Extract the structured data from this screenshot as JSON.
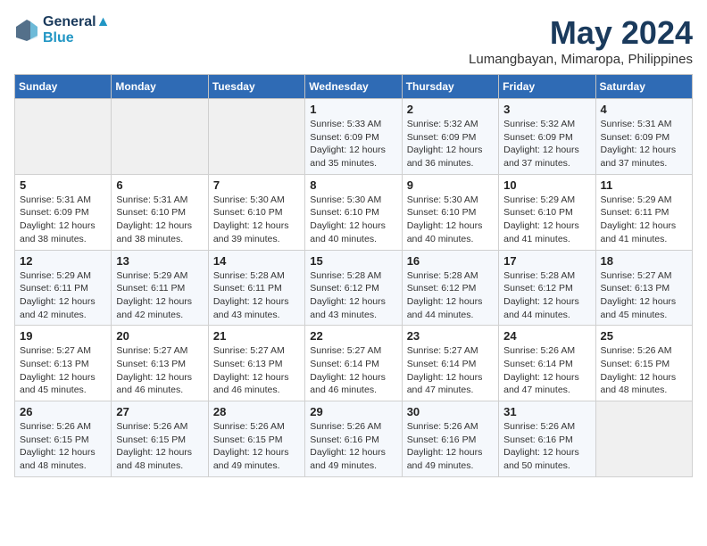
{
  "header": {
    "logo_line1": "General",
    "logo_line2": "Blue",
    "month": "May 2024",
    "location": "Lumangbayan, Mimaropa, Philippines"
  },
  "weekdays": [
    "Sunday",
    "Monday",
    "Tuesday",
    "Wednesday",
    "Thursday",
    "Friday",
    "Saturday"
  ],
  "weeks": [
    [
      {
        "day": "",
        "info": ""
      },
      {
        "day": "",
        "info": ""
      },
      {
        "day": "",
        "info": ""
      },
      {
        "day": "1",
        "info": "Sunrise: 5:33 AM\nSunset: 6:09 PM\nDaylight: 12 hours\nand 35 minutes."
      },
      {
        "day": "2",
        "info": "Sunrise: 5:32 AM\nSunset: 6:09 PM\nDaylight: 12 hours\nand 36 minutes."
      },
      {
        "day": "3",
        "info": "Sunrise: 5:32 AM\nSunset: 6:09 PM\nDaylight: 12 hours\nand 37 minutes."
      },
      {
        "day": "4",
        "info": "Sunrise: 5:31 AM\nSunset: 6:09 PM\nDaylight: 12 hours\nand 37 minutes."
      }
    ],
    [
      {
        "day": "5",
        "info": "Sunrise: 5:31 AM\nSunset: 6:09 PM\nDaylight: 12 hours\nand 38 minutes."
      },
      {
        "day": "6",
        "info": "Sunrise: 5:31 AM\nSunset: 6:10 PM\nDaylight: 12 hours\nand 38 minutes."
      },
      {
        "day": "7",
        "info": "Sunrise: 5:30 AM\nSunset: 6:10 PM\nDaylight: 12 hours\nand 39 minutes."
      },
      {
        "day": "8",
        "info": "Sunrise: 5:30 AM\nSunset: 6:10 PM\nDaylight: 12 hours\nand 40 minutes."
      },
      {
        "day": "9",
        "info": "Sunrise: 5:30 AM\nSunset: 6:10 PM\nDaylight: 12 hours\nand 40 minutes."
      },
      {
        "day": "10",
        "info": "Sunrise: 5:29 AM\nSunset: 6:10 PM\nDaylight: 12 hours\nand 41 minutes."
      },
      {
        "day": "11",
        "info": "Sunrise: 5:29 AM\nSunset: 6:11 PM\nDaylight: 12 hours\nand 41 minutes."
      }
    ],
    [
      {
        "day": "12",
        "info": "Sunrise: 5:29 AM\nSunset: 6:11 PM\nDaylight: 12 hours\nand 42 minutes."
      },
      {
        "day": "13",
        "info": "Sunrise: 5:29 AM\nSunset: 6:11 PM\nDaylight: 12 hours\nand 42 minutes."
      },
      {
        "day": "14",
        "info": "Sunrise: 5:28 AM\nSunset: 6:11 PM\nDaylight: 12 hours\nand 43 minutes."
      },
      {
        "day": "15",
        "info": "Sunrise: 5:28 AM\nSunset: 6:12 PM\nDaylight: 12 hours\nand 43 minutes."
      },
      {
        "day": "16",
        "info": "Sunrise: 5:28 AM\nSunset: 6:12 PM\nDaylight: 12 hours\nand 44 minutes."
      },
      {
        "day": "17",
        "info": "Sunrise: 5:28 AM\nSunset: 6:12 PM\nDaylight: 12 hours\nand 44 minutes."
      },
      {
        "day": "18",
        "info": "Sunrise: 5:27 AM\nSunset: 6:13 PM\nDaylight: 12 hours\nand 45 minutes."
      }
    ],
    [
      {
        "day": "19",
        "info": "Sunrise: 5:27 AM\nSunset: 6:13 PM\nDaylight: 12 hours\nand 45 minutes."
      },
      {
        "day": "20",
        "info": "Sunrise: 5:27 AM\nSunset: 6:13 PM\nDaylight: 12 hours\nand 46 minutes."
      },
      {
        "day": "21",
        "info": "Sunrise: 5:27 AM\nSunset: 6:13 PM\nDaylight: 12 hours\nand 46 minutes."
      },
      {
        "day": "22",
        "info": "Sunrise: 5:27 AM\nSunset: 6:14 PM\nDaylight: 12 hours\nand 46 minutes."
      },
      {
        "day": "23",
        "info": "Sunrise: 5:27 AM\nSunset: 6:14 PM\nDaylight: 12 hours\nand 47 minutes."
      },
      {
        "day": "24",
        "info": "Sunrise: 5:26 AM\nSunset: 6:14 PM\nDaylight: 12 hours\nand 47 minutes."
      },
      {
        "day": "25",
        "info": "Sunrise: 5:26 AM\nSunset: 6:15 PM\nDaylight: 12 hours\nand 48 minutes."
      }
    ],
    [
      {
        "day": "26",
        "info": "Sunrise: 5:26 AM\nSunset: 6:15 PM\nDaylight: 12 hours\nand 48 minutes."
      },
      {
        "day": "27",
        "info": "Sunrise: 5:26 AM\nSunset: 6:15 PM\nDaylight: 12 hours\nand 48 minutes."
      },
      {
        "day": "28",
        "info": "Sunrise: 5:26 AM\nSunset: 6:15 PM\nDaylight: 12 hours\nand 49 minutes."
      },
      {
        "day": "29",
        "info": "Sunrise: 5:26 AM\nSunset: 6:16 PM\nDaylight: 12 hours\nand 49 minutes."
      },
      {
        "day": "30",
        "info": "Sunrise: 5:26 AM\nSunset: 6:16 PM\nDaylight: 12 hours\nand 49 minutes."
      },
      {
        "day": "31",
        "info": "Sunrise: 5:26 AM\nSunset: 6:16 PM\nDaylight: 12 hours\nand 50 minutes."
      },
      {
        "day": "",
        "info": ""
      }
    ]
  ]
}
